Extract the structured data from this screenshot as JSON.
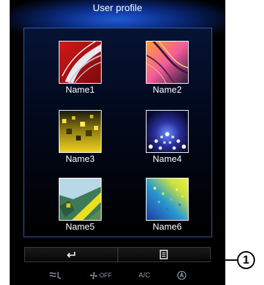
{
  "screen": {
    "title": "User profile"
  },
  "profiles": [
    {
      "name": "Name1",
      "image": "red-silver-wave"
    },
    {
      "name": "Name2",
      "image": "pink-orange-lines"
    },
    {
      "name": "Name3",
      "image": "yellow-pixel-gradient"
    },
    {
      "name": "Name4",
      "image": "blue-light-dots"
    },
    {
      "name": "Name5",
      "image": "green-yellow-abstract"
    },
    {
      "name": "Name6",
      "image": "yellow-blue-halftone"
    }
  ],
  "bottom_bar": {
    "back_icon": "back-arrow-icon",
    "menu_icon": "context-menu-icon"
  },
  "climate_bar": {
    "fan_label": "OFF",
    "ac_label": "A/C"
  },
  "callout": {
    "number": "1"
  },
  "colors": {
    "screen_background": "#000000",
    "panel_border": "#2f5fa8",
    "header_glow": "#1f5bd6",
    "climate_text": "#8e9ab0"
  }
}
